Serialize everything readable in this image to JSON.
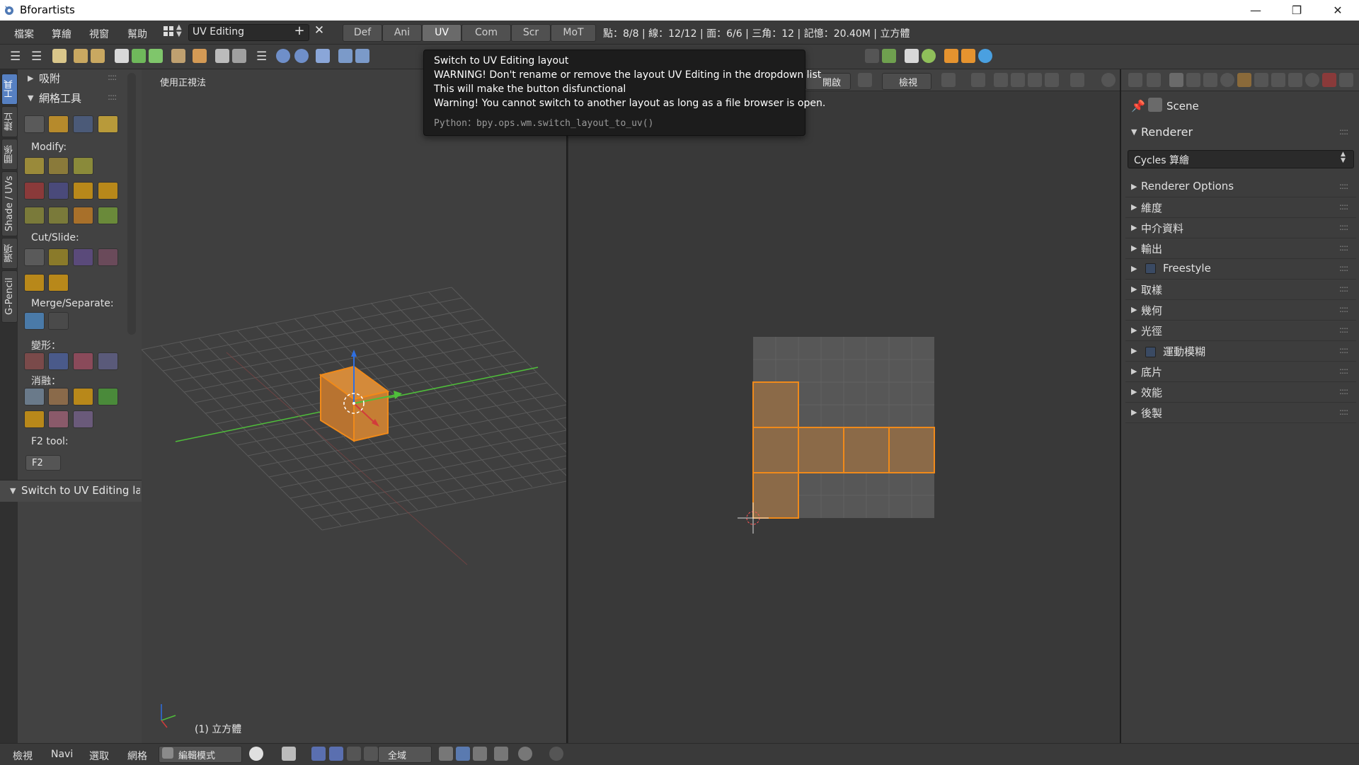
{
  "window": {
    "title": "Bforartists",
    "min_label": "—",
    "max_label": "❐",
    "close_label": "✕"
  },
  "menu": [
    "檔案",
    "算繪",
    "視窗",
    "幫助"
  ],
  "layout": {
    "name": "UV Editing",
    "add_label": "+",
    "close_label": "✕",
    "tabs": [
      "Def",
      "Ani",
      "UV",
      "Com",
      "Scr",
      "MoT"
    ],
    "active_tab": "UV"
  },
  "stats": "點：8/8 | 線：12/12 | 面：6/6 | 三角：12 | 記憶：20.40M | 立方體",
  "side_tabs": [
    "工具",
    "建立",
    "關係",
    "Shade / UVs",
    "選項",
    "G-Pencil"
  ],
  "tool_shelf": {
    "snap_panel": "吸附",
    "mesh_panel": "網格工具",
    "modify_label": "Modify:",
    "cutslide_label": "Cut/Slide:",
    "merge_label": "Merge/Separate:",
    "deform_label": "變形：",
    "dissolve_label": "消融：",
    "f2_label": "F2 tool:",
    "f2_button": "F2",
    "redo_panel": "Switch to UV Editing lay",
    "drag": "::::"
  },
  "viewport": {
    "view_label": "使用正視法",
    "object_label": "(1) 立方體"
  },
  "uv_header": {
    "open_label": "開啟",
    "view_label": "檢視"
  },
  "properties": {
    "scene": "Scene",
    "renderer_panel": "Renderer",
    "renderer_value": "Cycles 算繪",
    "rows": [
      {
        "label": "Renderer Options",
        "check": false
      },
      {
        "label": "維度",
        "check": false
      },
      {
        "label": "中介資料",
        "check": false
      },
      {
        "label": "輸出",
        "check": false
      },
      {
        "label": "Freestyle",
        "check": true
      },
      {
        "label": "取樣",
        "check": false
      },
      {
        "label": "幾何",
        "check": false
      },
      {
        "label": "光徑",
        "check": false
      },
      {
        "label": "運動模糊",
        "check": true
      },
      {
        "label": "底片",
        "check": false
      },
      {
        "label": "效能",
        "check": false
      },
      {
        "label": "後製",
        "check": false
      }
    ]
  },
  "bottom": {
    "view": "檢視",
    "navi": "Navi",
    "select": "選取",
    "mesh": "網格",
    "mode": "編輯模式",
    "pivot": "全域"
  },
  "tooltip": {
    "title": "Switch to UV Editing layout",
    "line1": "WARNING! Don't rename or remove the layout UV Editing in the dropdown list",
    "line2": "This will make the button disfunctional",
    "line3": "Warning! You cannot switch to another layout as long as a file browser is open.",
    "python": "Python：bpy.ops.wm.switch_layout_to_uv()"
  },
  "colors": {
    "face_fill": "#8b6a48",
    "edge_select": "#f08a1a",
    "active_tab": "#5680c2",
    "axis_x": "#d23b3b",
    "axis_y": "#4fbf3a",
    "axis_z": "#2f6fe0"
  }
}
